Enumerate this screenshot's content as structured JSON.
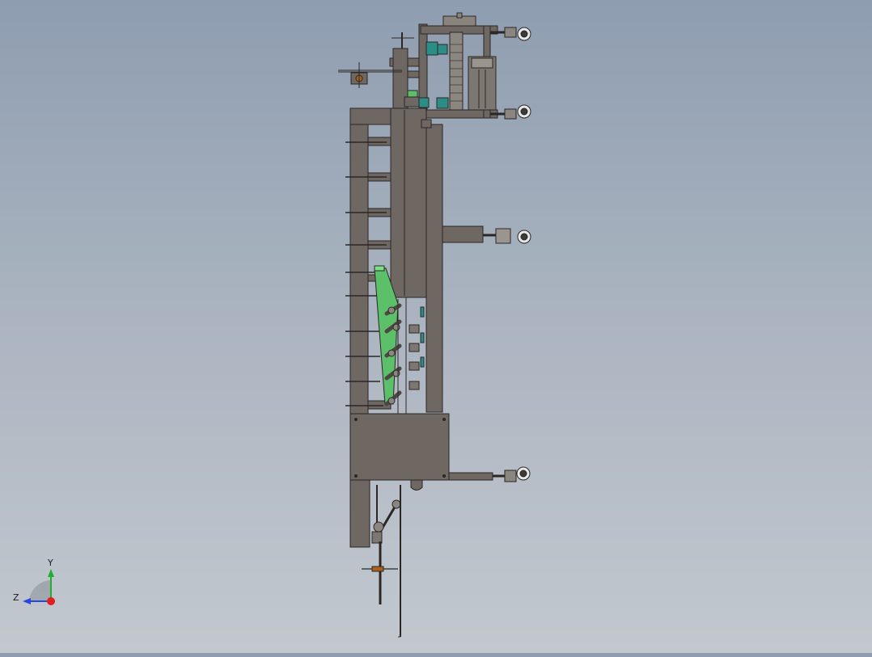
{
  "viewport": {
    "background_top": "#8e9db0",
    "background_bottom": "#c3c8cf"
  },
  "model": {
    "body_color": "#6e6762",
    "edge_color": "#2b2725",
    "highlight_green": "#5cbf6a",
    "highlight_teal": "#2c8c86",
    "wheel_color": "#3a3a3a"
  },
  "triad": {
    "y_label": "Y",
    "z_label": "Z",
    "y_color": "#1fae2f",
    "z_color": "#2a48d8",
    "x_color": "#e01e1e",
    "origin_icon": "axis-origin-icon"
  }
}
